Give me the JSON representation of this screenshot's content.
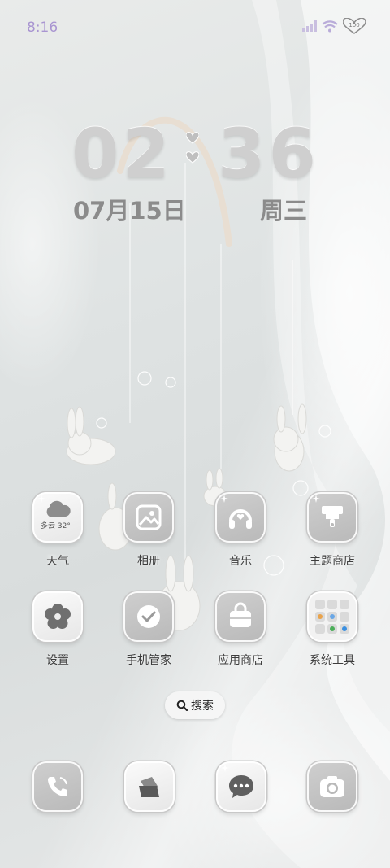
{
  "status_bar": {
    "time": "8:16",
    "battery": "100"
  },
  "clock": {
    "hour": "02",
    "minute": "36",
    "date": "07月15日",
    "weekday": "周三"
  },
  "apps": [
    {
      "label": "天气",
      "icon": "weather-icon",
      "weather_text": "多云 32°"
    },
    {
      "label": "相册",
      "icon": "gallery-icon"
    },
    {
      "label": "音乐",
      "icon": "music-icon"
    },
    {
      "label": "主题商店",
      "icon": "theme-store-icon"
    },
    {
      "label": "设置",
      "icon": "settings-icon"
    },
    {
      "label": "手机管家",
      "icon": "phone-manager-icon"
    },
    {
      "label": "应用商店",
      "icon": "app-store-icon"
    },
    {
      "label": "系统工具",
      "icon": "system-tools-folder-icon"
    }
  ],
  "search": {
    "label": "搜索"
  },
  "dock": [
    {
      "icon": "phone-icon"
    },
    {
      "icon": "files-icon"
    },
    {
      "icon": "messages-icon"
    },
    {
      "icon": "camera-icon"
    }
  ],
  "colors": {
    "status_time": "#a995d1",
    "clock": "#cfcfcf",
    "date": "#8b8b8b",
    "icon_glyph": "#6f6f6f"
  }
}
